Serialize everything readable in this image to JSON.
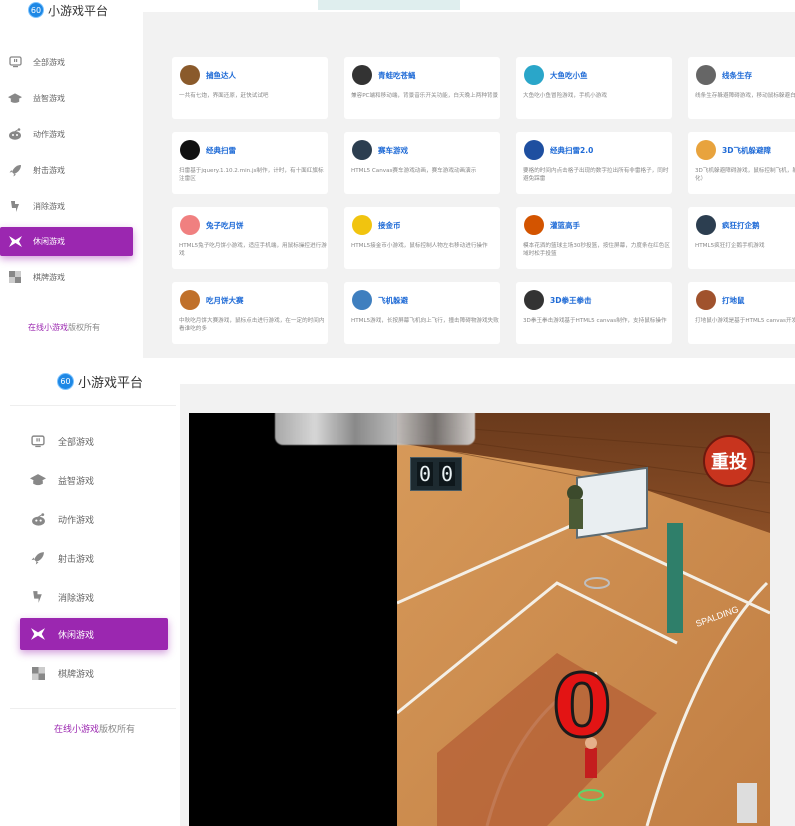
{
  "site": {
    "logo_glyph": "60",
    "name": "小游戏平台"
  },
  "sidebar": {
    "items": [
      {
        "label": "全部游戏",
        "icon": "tv-icon"
      },
      {
        "label": "益智游戏",
        "icon": "graduation-cap-icon"
      },
      {
        "label": "动作游戏",
        "icon": "reddit-alien-icon"
      },
      {
        "label": "射击游戏",
        "icon": "rocket-icon"
      },
      {
        "label": "消除游戏",
        "icon": "bolt-icon"
      },
      {
        "label": "休闲游戏",
        "icon": "bowtie-icon",
        "active": true
      },
      {
        "label": "棋牌游戏",
        "icon": "cards-icon"
      }
    ],
    "copyright_link": "在线小游戏",
    "copyright_rest": "版权所有"
  },
  "games": [
    {
      "title": "捕鱼达人",
      "desc": "一共有七炮，界面还原，赶快试试吧",
      "icon": "fish-icon",
      "color": "#8a5a2b"
    },
    {
      "title": "青蛙吃苍蝇",
      "desc": "兼容PC端和移动端，背景音乐开关功能，白天晚上两种背景",
      "icon": "frog-icon",
      "color": "#333333"
    },
    {
      "title": "大鱼吃小鱼",
      "desc": "大鱼吃小鱼冒险游戏，手机小游戏",
      "icon": "big-fish-icon",
      "color": "#2aa6c9"
    },
    {
      "title": "线条生存",
      "desc": "线条生存躲避障碍游戏，移动鼠标躲避白点，获得积分",
      "icon": "dot-icon",
      "color": "#666666"
    },
    {
      "title": "经典扫雷",
      "desc": "扫雷基于jquery.1.10.2.min.js制作，计时，有十面红旗标注雷区",
      "icon": "mine-icon",
      "color": "#111111"
    },
    {
      "title": "赛车游戏",
      "desc": "HTML5 Canvas赛车游戏动画，赛车游戏动画演示",
      "icon": "car-icon",
      "color": "#2c3e50"
    },
    {
      "title": "经典扫雷2.0",
      "desc": "要格的时间内点击格子出现的数字拉出所有非雷格子，同时避免踩雷",
      "icon": "mine2-icon",
      "color": "#1e4fa0"
    },
    {
      "title": "3D飞机躲避障",
      "desc": "3D飞机躲避障碍游戏，鼠标控制飞机，躲避障碍（小型玩化）",
      "icon": "plane3d-icon",
      "color": "#e8a33d"
    },
    {
      "title": "兔子吃月饼",
      "desc": "HTML5兔子吃月饼小游戏，适应手机端，用鼠标操控进行游戏",
      "icon": "rabbit-icon",
      "color": "#f08080"
    },
    {
      "title": "接金币",
      "desc": "HTML5接金币小游戏，鼠标控制人物左右移动进行操作",
      "icon": "coin-icon",
      "color": "#f1c40f"
    },
    {
      "title": "灌篮高手",
      "desc": "模本花洒的篮球主场30秒投篮，按住屏幕，力度条在红色区域时松手投篮",
      "icon": "basketball-icon",
      "color": "#d35400"
    },
    {
      "title": "疯狂打企鹅",
      "desc": "HTML5疯狂打企鹅手机游戏",
      "icon": "penguin-icon",
      "color": "#2c3e50"
    },
    {
      "title": "吃月饼大赛",
      "desc": "中秋吃月饼大赛游戏，鼠标点击进行游戏，在一定的时间内看谁吃的多",
      "icon": "mooncake-icon",
      "color": "#c0702a"
    },
    {
      "title": "飞机躲避",
      "desc": "HTML5游戏，长按屏幕飞机向上飞行，撞击障碍物游戏失败",
      "icon": "plane-icon",
      "color": "#3f7fbf"
    },
    {
      "title": "3D拳王拳击",
      "desc": "3D拳王拳击游戏基于HTML5 canvas制作，支持鼠标操作",
      "icon": "boxer-icon",
      "color": "#333333"
    },
    {
      "title": "打地鼠",
      "desc": "打地鼠小游戏是基于HTML5 canvas开发的小游戏",
      "icon": "mole-icon",
      "color": "#a0522d"
    }
  ],
  "game_view": {
    "score_digits": [
      "0",
      "0"
    ],
    "replay_label": "重投",
    "big_score": "0",
    "hoop_brand": "SPALDING"
  },
  "colors": {
    "accent": "#9b27b0",
    "link": "#1e6ad6"
  }
}
